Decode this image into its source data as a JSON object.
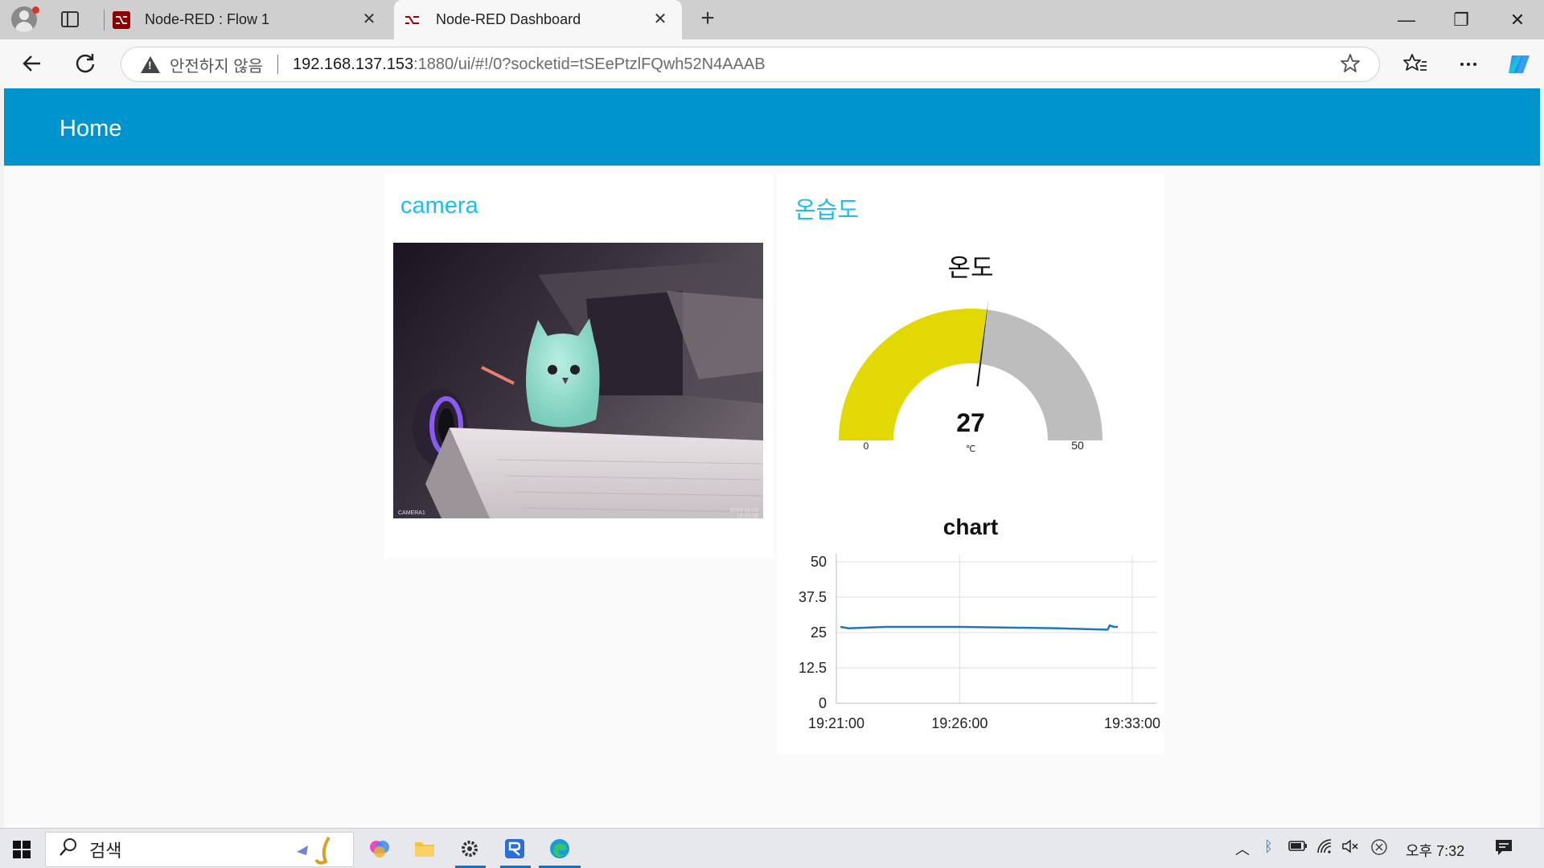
{
  "browser": {
    "tabs": [
      {
        "label": "Node-RED : Flow 1",
        "active": false
      },
      {
        "label": "Node-RED Dashboard",
        "active": true
      }
    ],
    "close_glyph": "✕",
    "new_tab_glyph": "+",
    "address": {
      "security_label": "안전하지 않음",
      "host": "192.168.137.153",
      "rest": ":1880/ui/#!/0?socketid=tSEePtzlFQwh52N4AAAB"
    },
    "window_controls": [
      "—",
      "❐",
      "✕"
    ],
    "icons": {
      "back": "back-arrow-icon",
      "reload": "reload-icon",
      "favorite": "star-icon",
      "favorites": "favorites-icon",
      "menu": "more-icon",
      "copilot": "copilot-icon"
    }
  },
  "dashboard": {
    "title": "Home",
    "accent_color": "#0094ce",
    "camera_card": {
      "title": "camera",
      "overlay_left": "CAMERA1",
      "overlay_right": "2024-11-05 19:33:08"
    },
    "env_card": {
      "title": "온습도",
      "gauge": {
        "title": "온도",
        "value": 27,
        "unit": "℃",
        "min": 0,
        "max": 50,
        "min_label": "0",
        "max_label": "50",
        "fill_color": "#e2d804",
        "track_color": "#bdbdbd"
      },
      "chart_title": "chart"
    }
  },
  "chart_data": {
    "type": "line",
    "title": "chart",
    "xlabel": "",
    "ylabel": "",
    "ylim": [
      0,
      50
    ],
    "yticks": [
      "50",
      "37.5",
      "25",
      "12.5",
      "0"
    ],
    "xticks": [
      "19:21:00",
      "19:26:00",
      "19:33:00"
    ],
    "grid": true,
    "series": [
      {
        "color": "#1f77b4",
        "x": [
          "19:21:10",
          "19:21:30",
          "19:23:00",
          "19:26:00",
          "19:30:00",
          "19:32:00",
          "19:32:05",
          "19:32:15",
          "19:32:25"
        ],
        "y": [
          27,
          26.5,
          27,
          27,
          26.5,
          26,
          27.5,
          27,
          27
        ]
      }
    ]
  },
  "taskbar": {
    "search_label": "검색",
    "clock": "오후 7:32"
  }
}
